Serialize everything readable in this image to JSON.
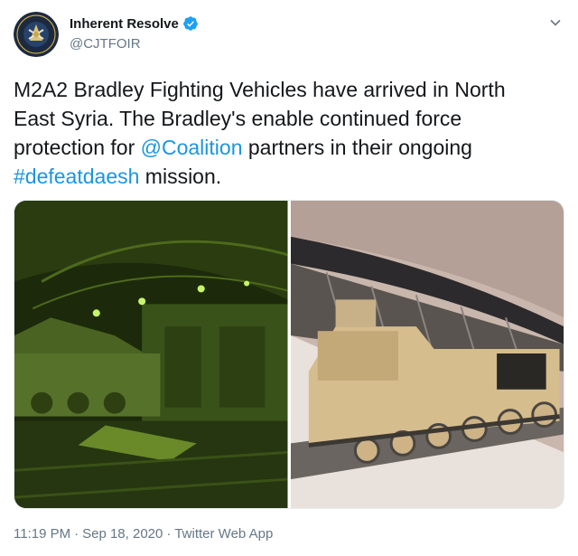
{
  "account": {
    "name": "Inherent Resolve",
    "handle": "@CJTFOIR",
    "verified": true,
    "avatar_icon": "cjtf-oir-seal",
    "avatar_text": [
      "COMBINED JOINT TASK FORCE",
      "OPERATION INHERENT RESOLVE"
    ]
  },
  "tweet": {
    "text_lines": [
      "M2A2 Bradley Fighting Vehicles have arrived in North",
      "East Syria. The Bradley's enable continued force"
    ],
    "line3_pre": "protection for ",
    "mention": "@Coalition",
    "line3_post": " partners in their ongoing",
    "hashtag": "#defeatdaesh",
    "line4_post": " mission."
  },
  "media": [
    {
      "icon": "bradley-in-aircraft-cargo-hold-night-vision"
    },
    {
      "icon": "bradley-unloading-from-aircraft-ramp"
    }
  ],
  "meta": {
    "time": "11:19 PM",
    "separator": "·",
    "date": "Sep 18, 2020",
    "app": "Twitter Web App"
  },
  "colors": {
    "link": "#1b95e0",
    "secondary": "#657786",
    "verified": "#1da1f2",
    "night_vision": "#3f5a18",
    "desert_tan": "#d6bd8e"
  }
}
